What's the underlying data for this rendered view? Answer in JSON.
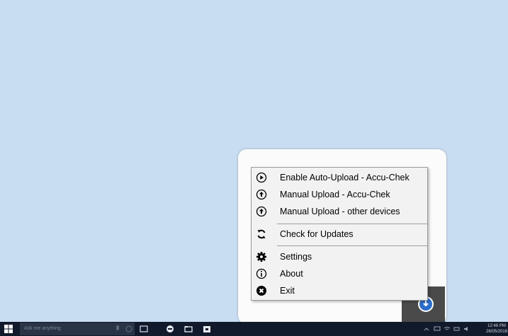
{
  "menu": {
    "items": [
      {
        "label": "Enable Auto-Upload - Accu-Chek",
        "icon": "play-circle-icon"
      },
      {
        "label": "Manual Upload - Accu-Chek",
        "icon": "upload-circle-icon"
      },
      {
        "label": "Manual Upload - other devices",
        "icon": "upload-circle-icon"
      },
      {
        "label": "Check for Updates",
        "icon": "refresh-icon"
      },
      {
        "label": "Settings",
        "icon": "gear-icon"
      },
      {
        "label": "About",
        "icon": "info-icon"
      },
      {
        "label": "Exit",
        "icon": "close-circle-icon"
      }
    ]
  },
  "taskbar": {
    "search_placeholder": "Ask me anything",
    "clock_time": "12:46 PM",
    "clock_date": "26/05/2016"
  },
  "colors": {
    "desktop": "#c9ddf2",
    "taskbar": "#111a2b",
    "menu_bg": "#f2f2f2",
    "accent": "#2a6fd0"
  }
}
